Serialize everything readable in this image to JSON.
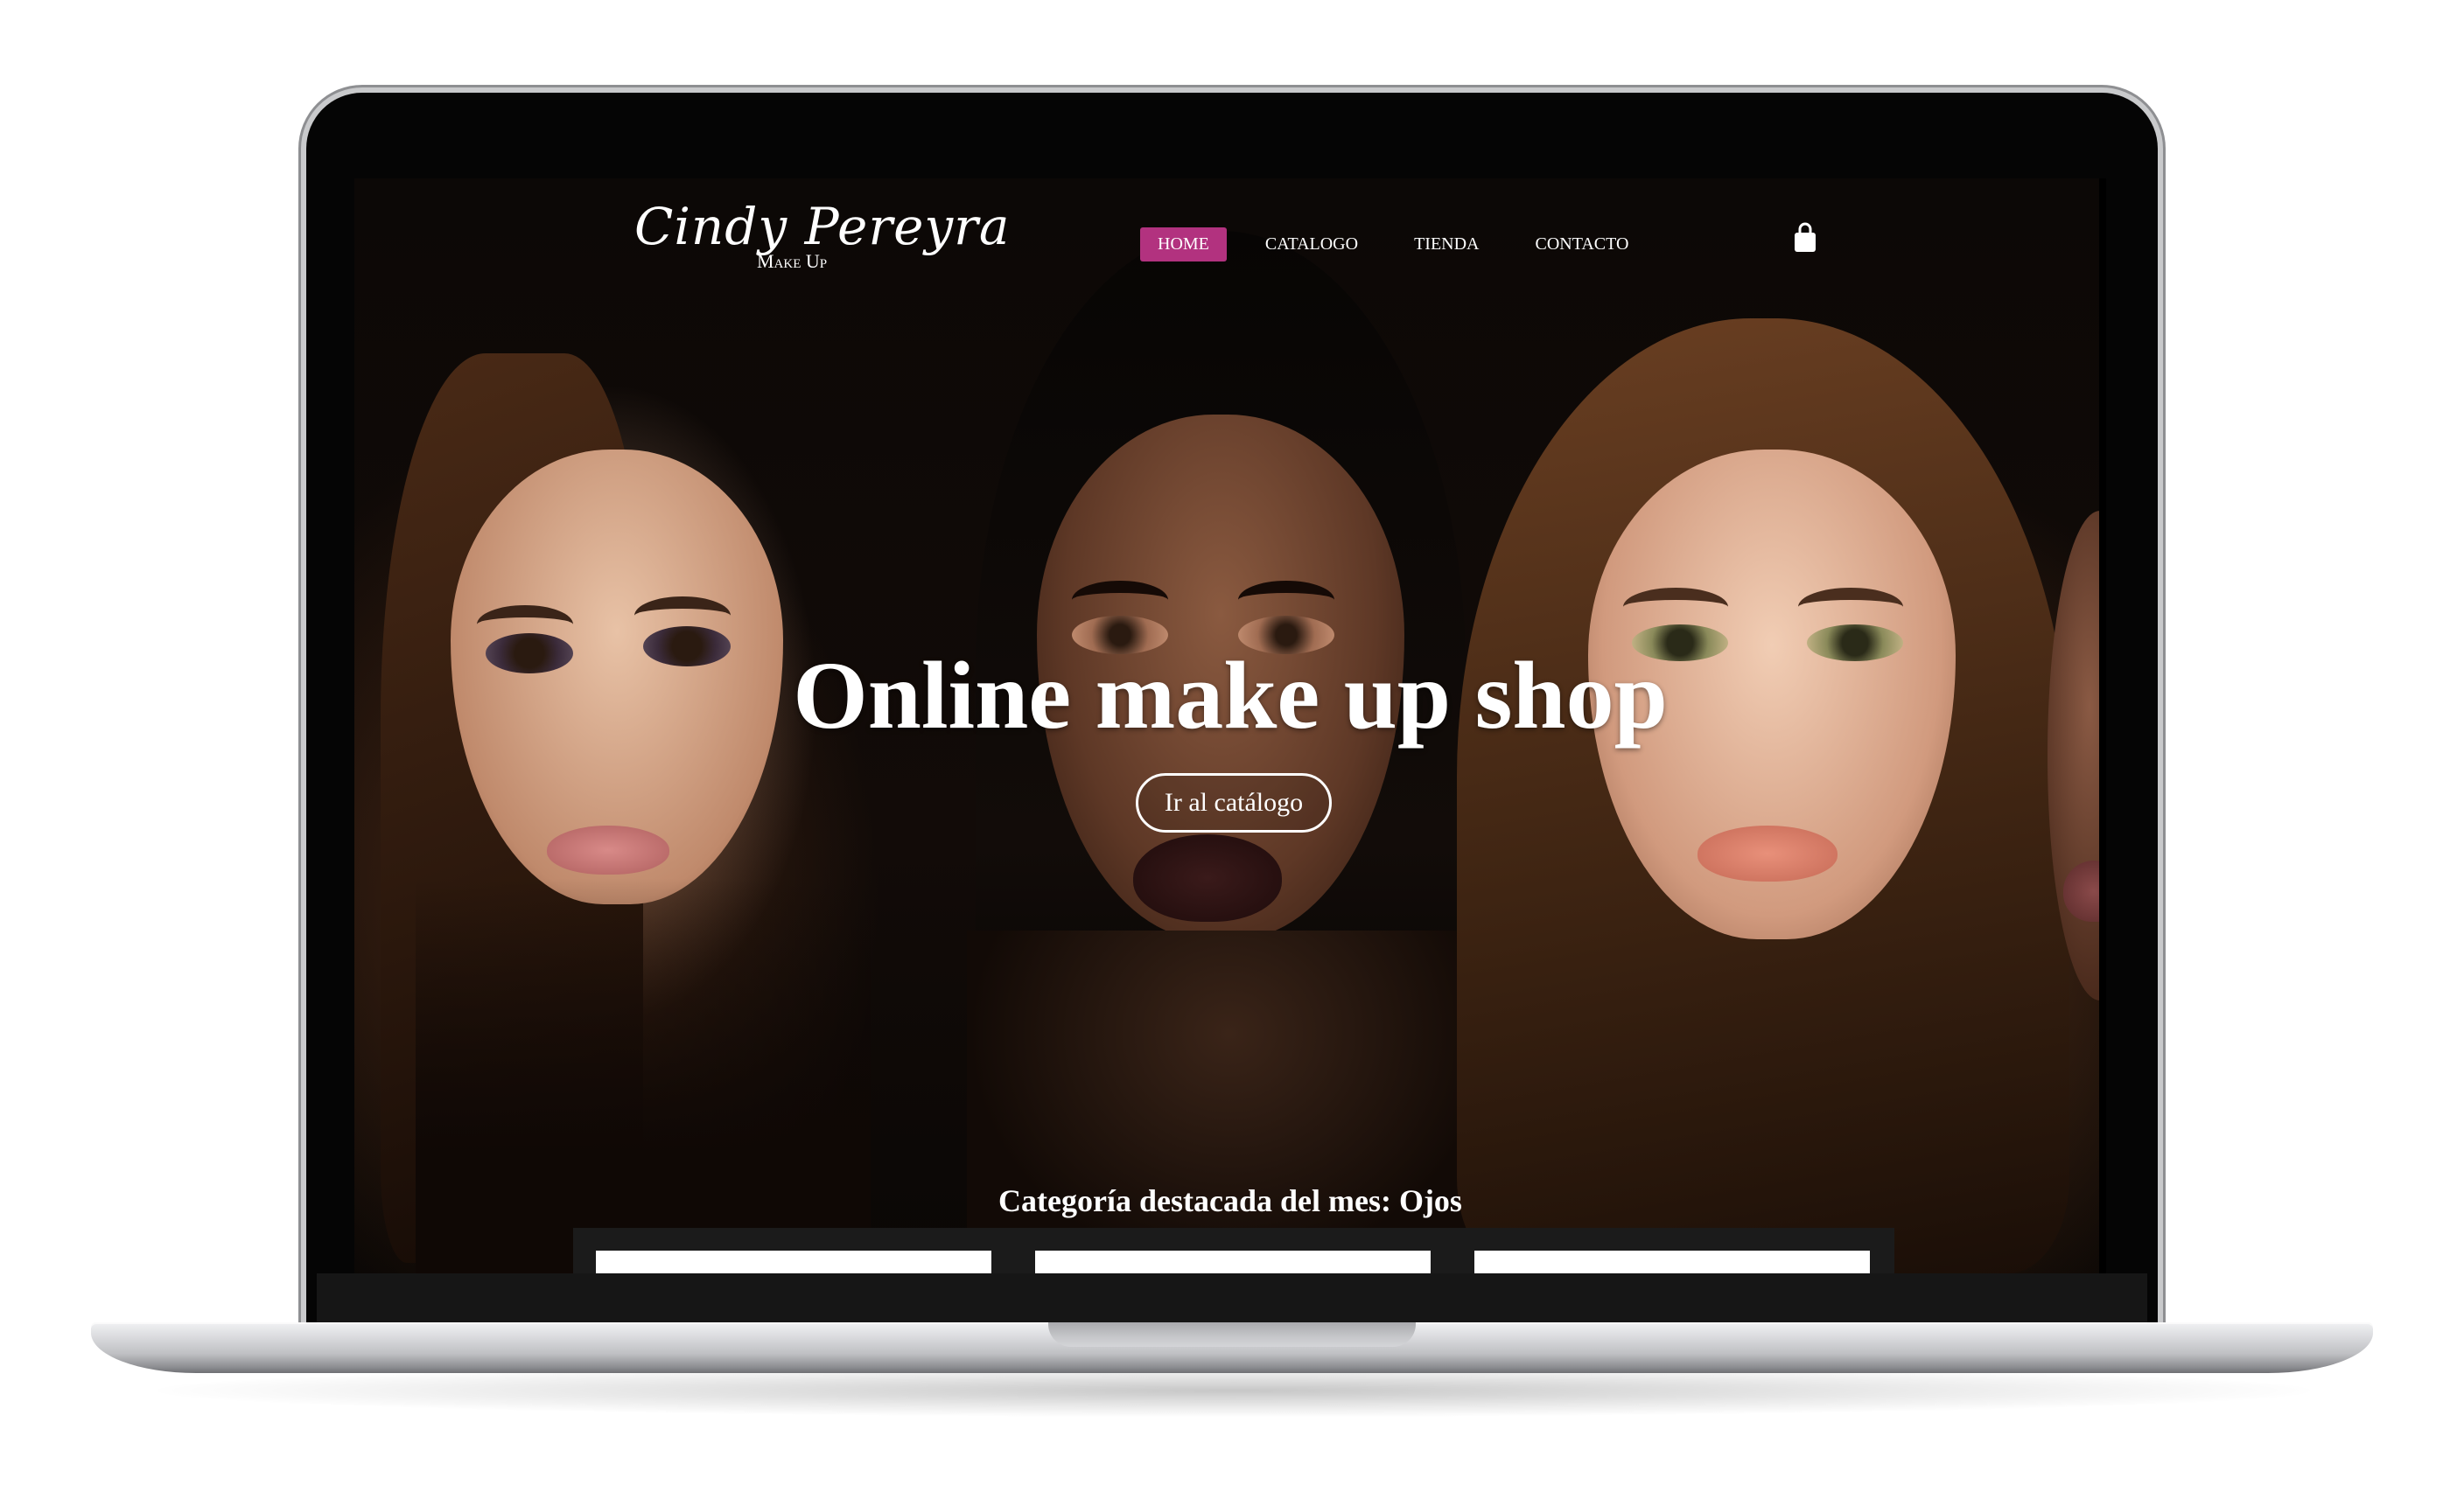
{
  "brand": {
    "name": "Cindy Pereyra",
    "tagline": "Make Up",
    "accent_color": "#b2327f"
  },
  "nav": {
    "items": [
      {
        "label": "HOME",
        "active": true
      },
      {
        "label": "CATALOGO",
        "active": false
      },
      {
        "label": "TIENDA",
        "active": false
      },
      {
        "label": "CONTACTO",
        "active": false
      }
    ],
    "cart_icon": "shopping-bag-icon"
  },
  "hero": {
    "title": "Online make up shop",
    "cta_label": "Ir al catálogo"
  },
  "featured": {
    "heading": "Categoría destacada del mes: Ojos"
  }
}
